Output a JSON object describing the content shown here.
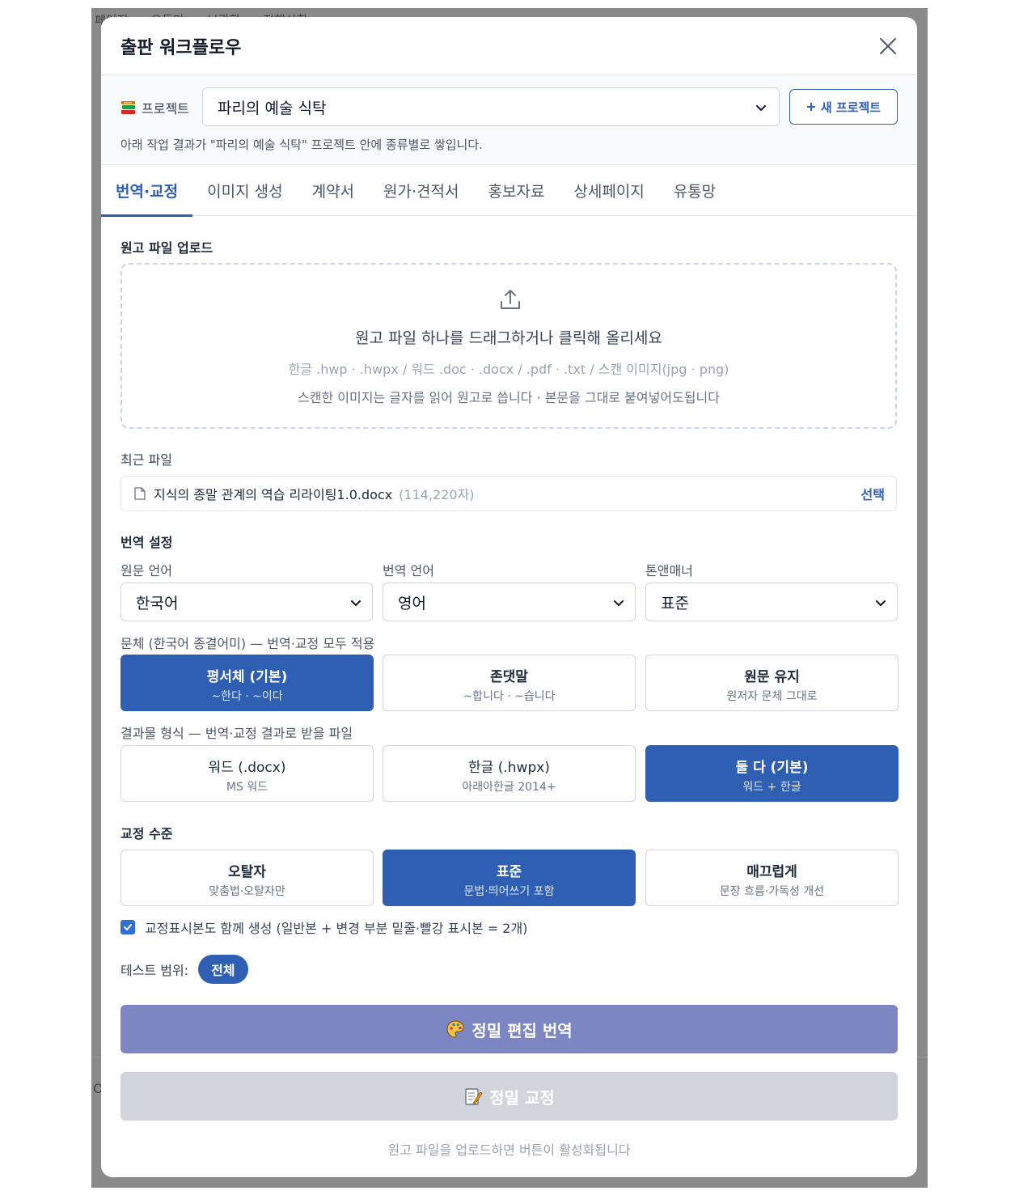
{
  "background": {
    "tabs": [
      "페이지",
      "오투만",
      "보관함",
      "진행상황"
    ],
    "stray_char": "O"
  },
  "modal": {
    "title": "출판 워크플로우",
    "close_icon": "close-icon"
  },
  "project": {
    "label": "프로젝트",
    "selected": "파리의 예술 식탁",
    "new_button": "새 프로젝트",
    "note": "아래 작업 결과가 \"파리의 예술 식탁\" 프로젝트 안에 종류별로 쌓입니다."
  },
  "tabs": [
    {
      "label": "번역·교정",
      "active": true
    },
    {
      "label": "이미지 생성",
      "active": false
    },
    {
      "label": "계약서",
      "active": false
    },
    {
      "label": "원가·견적서",
      "active": false
    },
    {
      "label": "홍보자료",
      "active": false
    },
    {
      "label": "상세페이지",
      "active": false
    },
    {
      "label": "유통망",
      "active": false
    }
  ],
  "upload": {
    "section_label": "원고 파일 업로드",
    "main_text": "원고 파일 하나를 드래그하거나 클릭해 올리세요",
    "formats": "한글 .hwp · .hwpx / 워드 .doc · .docx / .pdf · .txt / 스캔 이미지(jpg · png)",
    "scan_note": "스캔한 이미지는 글자를 읽어 원고로 씁니다 · 본문을 그대로 붙여넣어도됩니다"
  },
  "recent": {
    "section_label": "최근 파일",
    "file_name": "지식의 종말 관계의 역습 리라이팅1.0.docx",
    "char_count": "(114,220자)",
    "select_label": "선택"
  },
  "translation": {
    "section_label": "번역 설정",
    "source_label": "원문 언어",
    "source_value": "한국어",
    "target_label": "번역 언어",
    "target_value": "영어",
    "tone_label": "톤앤매너",
    "tone_value": "표준"
  },
  "style": {
    "label": "문체 (한국어 종결어미) — 번역·교정 모두 적용",
    "options": [
      {
        "title": "평서체 (기본)",
        "sub": "~한다 · ~이다",
        "selected": true
      },
      {
        "title": "존댓말",
        "sub": "~합니다 · ~습니다",
        "selected": false
      },
      {
        "title": "원문 유지",
        "sub": "원저자 문체 그대로",
        "selected": false
      }
    ]
  },
  "output": {
    "label": "결과물 형식 — 번역·교정 결과로 받을 파일",
    "options": [
      {
        "title": "워드 (.docx)",
        "sub": "MS 워드",
        "selected": false
      },
      {
        "title": "한글 (.hwpx)",
        "sub": "아래아한글 2014+",
        "selected": false
      },
      {
        "title": "둘 다 (기본)",
        "sub": "워드 + 한글",
        "selected": true
      }
    ]
  },
  "proof": {
    "section_label": "교정 수준",
    "options": [
      {
        "title": "오탈자",
        "sub": "맞춤법·오탈자만",
        "selected": false
      },
      {
        "title": "표준",
        "sub": "문법·띄어쓰기 포함",
        "selected": true
      },
      {
        "title": "매끄럽게",
        "sub": "문장 흐름·가독성 개선",
        "selected": false
      }
    ]
  },
  "markup_checkbox": {
    "checked": true,
    "label": "교정표시본도 함께 생성 (일반본 + 변경 부분 밑줄·빨강 표시본 = 2개)"
  },
  "test_range": {
    "label": "테스트 범위:",
    "value": "전체"
  },
  "actions": {
    "translate_label": "정밀 편집 번역",
    "translate_icon": "palette-icon",
    "proof_label": "정밀 교정",
    "proof_icon": "memo-icon",
    "hint": "원고 파일을 업로드하면 버튼이 활성화됩니다"
  },
  "colors": {
    "accent": "#2f5fb3",
    "translate_button": "#7c86c2",
    "disabled_button": "#d1d5db"
  }
}
